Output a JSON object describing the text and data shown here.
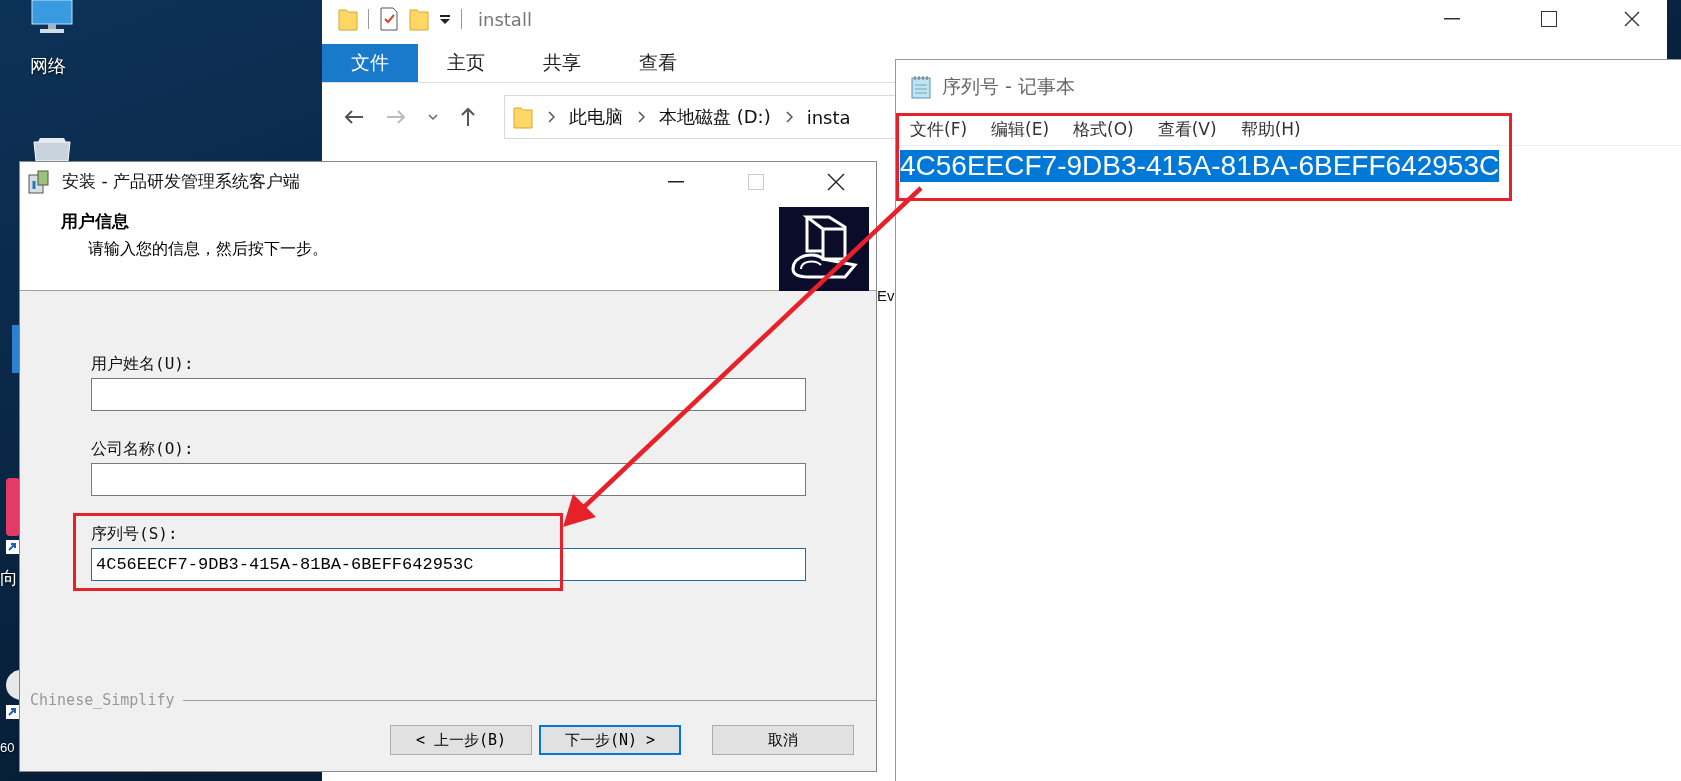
{
  "desktop": {
    "icons": [
      {
        "label": "网络"
      },
      {
        "label": "向"
      },
      {
        "label": "60"
      }
    ]
  },
  "explorer": {
    "title": "install",
    "ribbon_tabs": [
      {
        "label": "文件",
        "selected": true
      },
      {
        "label": "主页",
        "selected": false
      },
      {
        "label": "共享",
        "selected": false
      },
      {
        "label": "查看",
        "selected": false
      }
    ],
    "breadcrumb": [
      "此电脑",
      "本地磁盘 (D:)",
      "insta"
    ],
    "file_list_fragment": "Ev"
  },
  "installer": {
    "title": "安装 - 产品研发管理系统客户端",
    "heading": "用户信息",
    "subheading": "请输入您的信息，然后按下一步。",
    "fields": [
      {
        "label": "用户姓名(U):",
        "focused": false
      },
      {
        "label": "公司名称(O):",
        "focused": false
      },
      {
        "label": "序列号(S):",
        "value": "4C56EECF7-9DB3-415A-81BA-6BEFF642953C",
        "focused": true
      }
    ],
    "language": "Chinese_Simplify",
    "buttons": [
      {
        "label": "< 上一步(B)",
        "default": false
      },
      {
        "label": "下一步(N) >",
        "default": true
      },
      {
        "label": "取消",
        "default": false
      }
    ]
  },
  "notepad": {
    "title": "序列号 - 记事本",
    "menu": [
      "文件(F)",
      "编辑(E)",
      "格式(O)",
      "查看(V)",
      "帮助(H)"
    ],
    "text": "4C56EECF7-9DB3-415A-81BA-6BEFF642953C",
    "highlighted": true
  }
}
